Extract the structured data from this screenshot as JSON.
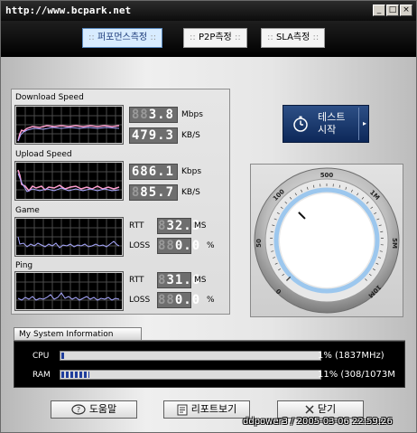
{
  "window": {
    "title": "http://www.bcpark.net",
    "minimize": "_",
    "maximize": "□",
    "close": "×"
  },
  "tabs": [
    {
      "label": "퍼포먼스측정",
      "active": true
    },
    {
      "label": "P2P측정",
      "active": false
    },
    {
      "label": "SLA측정",
      "active": false
    }
  ],
  "tab_dots": "::",
  "download": {
    "label": "Download Speed",
    "mbps_ghost": "88",
    "mbps": "3.8",
    "mbps_unit": "Mbps",
    "kbs_ghost": "",
    "kbs": "479.3",
    "kbs_unit": "KB/S"
  },
  "upload": {
    "label": "Upload Speed",
    "kbps_ghost": "",
    "kbps": "686.1",
    "kbps_unit": "Kbps",
    "kbs_ghost": "8",
    "kbs": "85.7",
    "kbs_unit": "KB/S"
  },
  "game": {
    "label": "Game",
    "rtt_label": "RTT",
    "rtt_ghost": "8",
    "rtt": "32.3",
    "rtt_unit": "MS",
    "loss_label": "LOSS",
    "loss_ghost": "88",
    "loss": "0.0",
    "loss_unit": "%"
  },
  "ping": {
    "label": "Ping",
    "rtt_label": "RTT",
    "rtt_ghost": "8",
    "rtt": "31.6",
    "rtt_unit": "MS",
    "loss_label": "LOSS",
    "loss_ghost": "88",
    "loss": "0.0",
    "loss_unit": "%"
  },
  "test_button": {
    "line1": "테스트",
    "line2": "시작"
  },
  "gauge": {
    "ticks": [
      "0",
      "50",
      "100",
      "500",
      "1M",
      "5M",
      "10M"
    ],
    "needle_value": "100"
  },
  "system": {
    "header": "My System Information",
    "cpu": {
      "label": "CPU",
      "percent": 1,
      "value": "1% (1837MHz)"
    },
    "ram": {
      "label": "RAM",
      "percent": 11,
      "value": "11% (308/1073M"
    }
  },
  "buttons": {
    "help": "도움말",
    "report": "리포트보기",
    "close": "닫기"
  },
  "credit": "ddpower3 / 2005-03-06 22:59:26",
  "colors": {
    "graph_line": "#a8a8ff",
    "graph_peak": "#ff9fcf",
    "accent": "#1f3d9c",
    "title_bg": "#000000"
  }
}
